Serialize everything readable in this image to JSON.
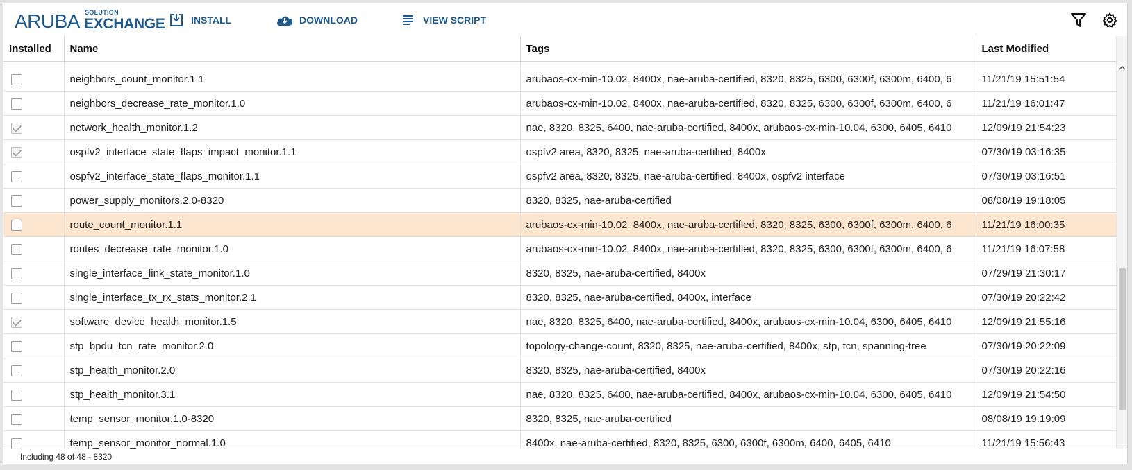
{
  "brand": {
    "primary": "ARUBA",
    "solution": "SOLUTION",
    "exchange": "EXCHANGE",
    "color": "#1e5a8c"
  },
  "toolbar": {
    "install_label": "INSTALL",
    "download_label": "DOWNLOAD",
    "view_script_label": "VIEW SCRIPT",
    "icons": [
      "install-icon",
      "download-cloud-icon",
      "list-lines-icon",
      "filter-funnel-icon",
      "gear-icon"
    ]
  },
  "table": {
    "columns": [
      "Installed",
      "Name",
      "Tags",
      "Last Modified"
    ],
    "highlight_color": "#fde6cf",
    "rows": [
      {
        "installed": false,
        "name": "neighbors_count_monitor.1.1",
        "tags": "arubaos-cx-min-10.02, 8400x, nae-aruba-certified, 8320, 8325, 6300, 6300f, 6300m, 6400, 6",
        "modified": "11/21/19 15:51:54",
        "highlighted": false
      },
      {
        "installed": false,
        "name": "neighbors_decrease_rate_monitor.1.0",
        "tags": "arubaos-cx-min-10.02, 8400x, nae-aruba-certified, 8320, 8325, 6300, 6300f, 6300m, 6400, 6",
        "modified": "11/21/19 16:01:47",
        "highlighted": false
      },
      {
        "installed": true,
        "name": "network_health_monitor.1.2",
        "tags": "nae, 8320, 8325, 6400, nae-aruba-certified, 8400x, arubaos-cx-min-10.04, 6300, 6405, 6410",
        "modified": "12/09/19 21:54:23",
        "highlighted": false
      },
      {
        "installed": true,
        "name": "ospfv2_interface_state_flaps_impact_monitor.1.1",
        "tags": "ospfv2 area, 8320, 8325, nae-aruba-certified, 8400x",
        "modified": "07/30/19 03:16:35",
        "highlighted": false
      },
      {
        "installed": false,
        "name": "ospfv2_interface_state_flaps_monitor.1.1",
        "tags": "ospfv2 area, 8320, 8325, nae-aruba-certified, 8400x, ospfv2 interface",
        "modified": "07/30/19 03:16:51",
        "highlighted": false
      },
      {
        "installed": false,
        "name": "power_supply_monitors.2.0-8320",
        "tags": "8320, 8325, nae-aruba-certified",
        "modified": "08/08/19 19:18:05",
        "highlighted": false
      },
      {
        "installed": false,
        "name": "route_count_monitor.1.1",
        "tags": "arubaos-cx-min-10.02, 8400x, nae-aruba-certified, 8320, 8325, 6300, 6300f, 6300m, 6400, 6",
        "modified": "11/21/19 16:00:35",
        "highlighted": true
      },
      {
        "installed": false,
        "name": "routes_decrease_rate_monitor.1.0",
        "tags": "arubaos-cx-min-10.02, 8400x, nae-aruba-certified, 8320, 8325, 6300, 6300f, 6300m, 6400, 6",
        "modified": "11/21/19 16:07:58",
        "highlighted": false
      },
      {
        "installed": false,
        "name": "single_interface_link_state_monitor.1.0",
        "tags": "8320, 8325, nae-aruba-certified, 8400x",
        "modified": "07/29/19 21:30:17",
        "highlighted": false
      },
      {
        "installed": false,
        "name": "single_interface_tx_rx_stats_monitor.2.1",
        "tags": "8320, 8325, nae-aruba-certified, 8400x, interface",
        "modified": "07/30/19 20:22:42",
        "highlighted": false
      },
      {
        "installed": true,
        "name": "software_device_health_monitor.1.5",
        "tags": "nae, 8320, 8325, 6400, nae-aruba-certified, 8400x, arubaos-cx-min-10.04, 6300, 6405, 6410",
        "modified": "12/09/19 21:55:16",
        "highlighted": false
      },
      {
        "installed": false,
        "name": "stp_bpdu_tcn_rate_monitor.2.0",
        "tags": "topology-change-count, 8320, 8325, nae-aruba-certified, 8400x, stp, tcn, spanning-tree",
        "modified": "07/30/19 20:22:09",
        "highlighted": false
      },
      {
        "installed": false,
        "name": "stp_health_monitor.2.0",
        "tags": "8320, 8325, nae-aruba-certified, 8400x",
        "modified": "07/30/19 20:22:16",
        "highlighted": false
      },
      {
        "installed": false,
        "name": "stp_health_monitor.3.1",
        "tags": "nae, 8320, 8325, 6400, nae-aruba-certified, 8400x, arubaos-cx-min-10.04, 6300, 6405, 6410",
        "modified": "12/09/19 21:54:50",
        "highlighted": false
      },
      {
        "installed": false,
        "name": "temp_sensor_monitor.1.0-8320",
        "tags": "8320, 8325, nae-aruba-certified",
        "modified": "08/08/19 19:19:09",
        "highlighted": false
      },
      {
        "installed": false,
        "name": "temp_sensor_monitor_normal.1.0",
        "tags": "8400x, nae-aruba-certified, 8320, 8325, 6300, 6300f, 6300m, 6400, 6405, 6410",
        "modified": "11/21/19 15:56:43",
        "highlighted": false
      }
    ]
  },
  "footer": {
    "status": "Including 48 of 48 - 8320"
  }
}
